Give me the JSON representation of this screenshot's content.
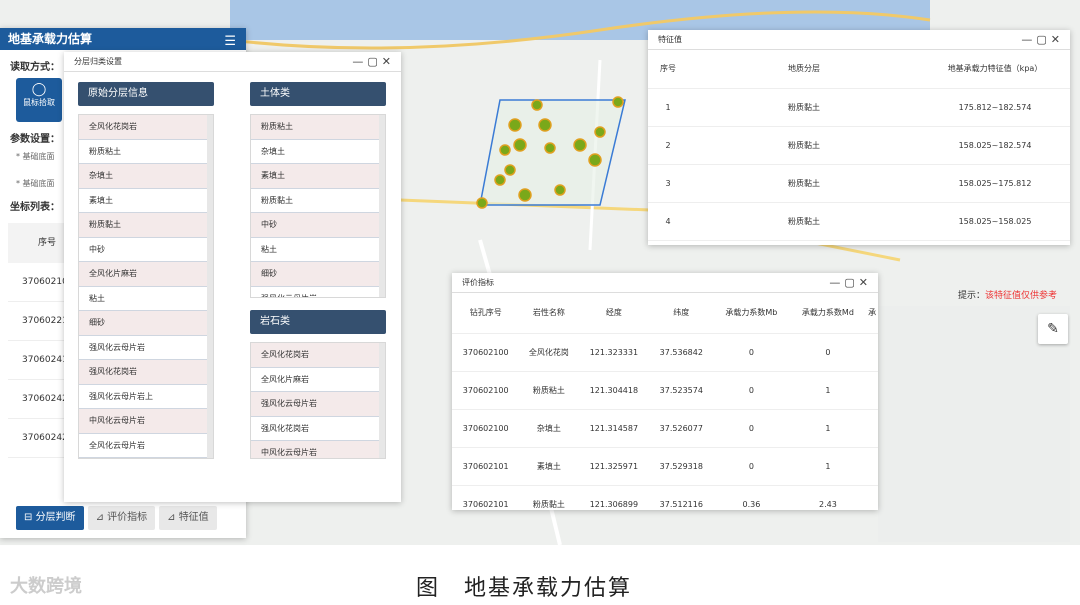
{
  "app": {
    "title": "地基承载力估算",
    "read_mode_label": "读取方式：",
    "mouse_pick_label": "鼠标拾取",
    "params_label": "参数设置：",
    "param1": "* 基础底面",
    "param2": "* 基础底面",
    "coord_list_label": "坐标列表：",
    "coord_header": "序号",
    "coord_rows": [
      "37060210",
      "37060221",
      "37060241",
      "37060242",
      "37060242"
    ]
  },
  "buttons": {
    "layer": "分层判断",
    "eval": "评价指标",
    "feature": "特征值"
  },
  "layer_dialog": {
    "title": "分层归类设置",
    "col_original": "原始分层信息",
    "col_soil": "土体类",
    "col_rock": "岩石类",
    "original": [
      "全风化花岗岩",
      "粉质粘土",
      "杂填土",
      "素填土",
      "粉质黏土",
      "中砂",
      "全风化片麻岩",
      "粘土",
      "细砂",
      "强风化云母片岩",
      "强风化花岗岩",
      "强风化云母片岩上",
      "中风化云母片岩",
      "全风化云母片岩"
    ],
    "soil": [
      "粉质粘土",
      "杂填土",
      "素填土",
      "粉质黏土",
      "中砂",
      "粘土",
      "细砂",
      "强风化云母片岩"
    ],
    "rock": [
      "全风化花岗岩",
      "全风化片麻岩",
      "强风化云母片岩",
      "强风化花岗岩",
      "中风化云母片岩"
    ]
  },
  "feature_dialog": {
    "title": "特征值",
    "headers": [
      "序号",
      "地质分层",
      "地基承载力特征值（kpa）"
    ],
    "rows": [
      [
        "1",
        "粉质黏土",
        "175.812~182.574"
      ],
      [
        "2",
        "粉质黏土",
        "158.025~182.574"
      ],
      [
        "3",
        "粉质黏土",
        "158.025~175.812"
      ],
      [
        "4",
        "粉质黏土",
        "158.025~158.025"
      ]
    ]
  },
  "eval_dialog": {
    "title": "评价指标",
    "headers": [
      "钻孔序号",
      "岩性名称",
      "经度",
      "纬度",
      "承载力系数Mb",
      "承载力系数Md",
      "承"
    ],
    "rows": [
      [
        "370602100",
        "全风化花岗",
        "121.323331",
        "37.536842",
        "0",
        "0"
      ],
      [
        "370602100",
        "粉质粘土",
        "121.304418",
        "37.523574",
        "0",
        "1"
      ],
      [
        "370602100",
        "杂填土",
        "121.314587",
        "37.526077",
        "0",
        "1"
      ],
      [
        "370602101",
        "素填土",
        "121.325971",
        "37.529318",
        "0",
        "1"
      ],
      [
        "370602101",
        "粉质黏土",
        "121.306899",
        "37.512116",
        "0.36",
        "2.43"
      ]
    ]
  },
  "hint": {
    "prefix": "提示：",
    "text": "该特征值仅供参考"
  },
  "caption": "图　地基承载力估算",
  "watermark": "大数跨境",
  "colors": {
    "primary": "#1d5b9c",
    "header_dark": "#35506f",
    "warn": "#e33"
  }
}
